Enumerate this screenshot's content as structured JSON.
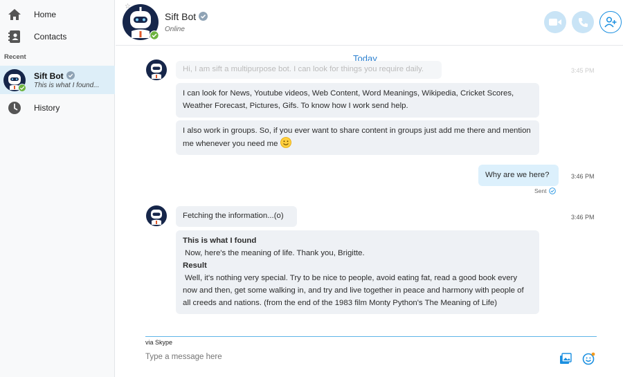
{
  "sidebar": {
    "nav": [
      {
        "label": "Home",
        "icon": "home-icon"
      },
      {
        "label": "Contacts",
        "icon": "contacts-icon"
      }
    ],
    "recent_title": "Recent",
    "recent": [
      {
        "name": "Sift Bot",
        "preview": "This is what I found..."
      }
    ],
    "history_label": "History"
  },
  "header": {
    "title": "Sift Bot",
    "status": "Online",
    "buttons": [
      "video-call-icon",
      "audio-call-icon",
      "add-contact-icon"
    ]
  },
  "chat": {
    "date_divider": "Today",
    "messages": [
      {
        "text": "Hi, I am sift a multipurpose bot. I can look for things you require daily.",
        "time": "3:45 PM"
      },
      {
        "text": "I can look for News, Youtube videos, Web Content, Word Meanings, Wikipedia, Cricket Scores, Weather Forecast, Pictures, Gifs. To know how I work send help."
      },
      {
        "text": "I also work in groups. So, if you ever want to share content in groups just add me there and mention me whenever you need me"
      },
      {
        "text": "Why are we here?",
        "time": "3:46 PM",
        "status": "Sent"
      },
      {
        "text": "Fetching the information...(o)",
        "time": "3:46 PM"
      },
      {
        "heading": "This is what I found",
        "line1": "Now, here's the meaning of life. Thank you, Brigitte.",
        "result_label": "Result",
        "result_text": "Well, it's nothing very special. Try to be nice to people, avoid eating fat, read a good book every now and then, get some walking in, and try and live together in peace and harmony with people of all creeds and nations. (from the end of the 1983 film Monty Python's The Meaning of Life)"
      }
    ]
  },
  "compose": {
    "via": "via Skype",
    "placeholder": "Type a message here"
  },
  "colors": {
    "accent": "#1a8fe0",
    "online": "#6cb33e",
    "selected": "#ddeef8"
  }
}
